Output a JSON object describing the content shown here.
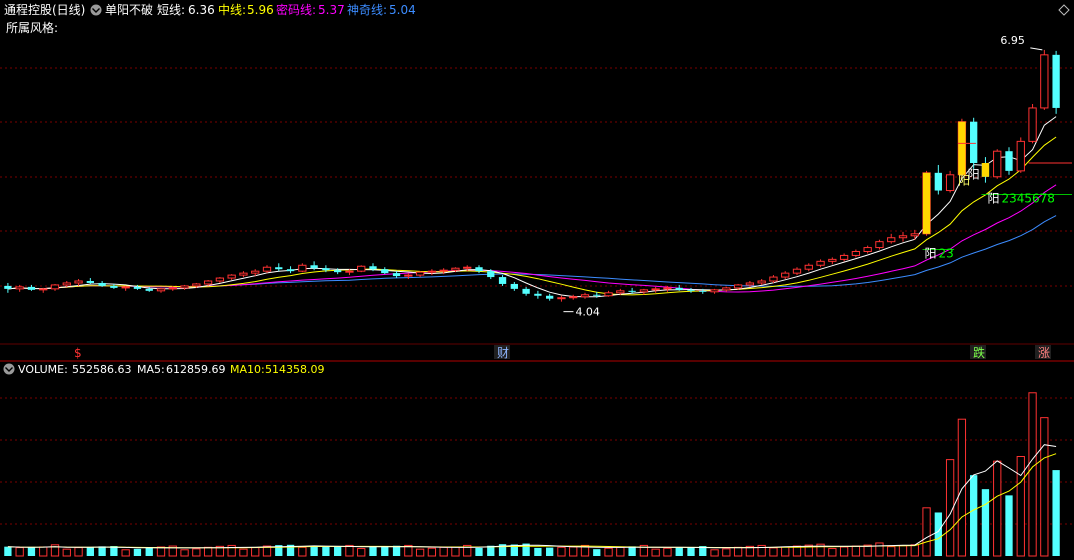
{
  "header": {
    "stock_title": "通程控股(日线)",
    "indicator_name": "单阳不破",
    "short_label": "短线:",
    "short_value": "6.36",
    "mid_label": "中线:",
    "mid_value": "5.96",
    "secret_label": "密码线:",
    "secret_value": "5.37",
    "magic_label": "神奇线:",
    "magic_value": "5.04",
    "style_label": "所属风格:"
  },
  "volume_header": {
    "volume_label": "VOLUME:",
    "volume_value": "552586.63",
    "ma5_label": "MA5:",
    "ma5_value": "612859.69",
    "ma10_label": "MA10:",
    "ma10_value": "514358.09"
  },
  "annotations": {
    "high": "6.95",
    "low": "4.04",
    "yang_marks": [
      "阳",
      "阳",
      "阳",
      "阳"
    ],
    "yang_count_a": "23",
    "yang_count_b": "2345678",
    "event_markers": [
      "$",
      "财",
      "跌",
      "涨"
    ]
  },
  "colors": {
    "up": "#ff3232",
    "down": "#54ffff",
    "short_line": "#ffffff",
    "mid_line": "#ffff00",
    "secret_line": "#ff00ff",
    "magic_line": "#3c8cff",
    "grid": "#7a0000",
    "highlight": "#ffd700"
  },
  "chart_data": [
    {
      "type": "candlestick",
      "title": "通程控股(日线)",
      "ylim": [
        4.0,
        7.0
      ],
      "series": [
        {
          "name": "短线",
          "last": 6.36
        },
        {
          "name": "中线",
          "last": 5.96
        },
        {
          "name": "密码线",
          "last": 5.37
        },
        {
          "name": "神奇线",
          "last": 5.04
        }
      ],
      "candles": [
        [
          4.55,
          4.58,
          4.48,
          4.52
        ],
        [
          4.52,
          4.56,
          4.49,
          4.54
        ],
        [
          4.54,
          4.56,
          4.5,
          4.51
        ],
        [
          4.51,
          4.53,
          4.48,
          4.52
        ],
        [
          4.52,
          4.57,
          4.5,
          4.56
        ],
        [
          4.56,
          4.6,
          4.54,
          4.58
        ],
        [
          4.58,
          4.62,
          4.55,
          4.6
        ],
        [
          4.6,
          4.63,
          4.57,
          4.58
        ],
        [
          4.58,
          4.6,
          4.54,
          4.55
        ],
        [
          4.55,
          4.57,
          4.52,
          4.53
        ],
        [
          4.53,
          4.55,
          4.5,
          4.54
        ],
        [
          4.54,
          4.56,
          4.51,
          4.52
        ],
        [
          4.52,
          4.54,
          4.49,
          4.5
        ],
        [
          4.5,
          4.53,
          4.48,
          4.52
        ],
        [
          4.52,
          4.55,
          4.5,
          4.53
        ],
        [
          4.53,
          4.56,
          4.51,
          4.55
        ],
        [
          4.55,
          4.58,
          4.53,
          4.57
        ],
        [
          4.57,
          4.61,
          4.55,
          4.6
        ],
        [
          4.6,
          4.64,
          4.58,
          4.63
        ],
        [
          4.63,
          4.67,
          4.61,
          4.66
        ],
        [
          4.66,
          4.7,
          4.64,
          4.68
        ],
        [
          4.68,
          4.72,
          4.65,
          4.7
        ],
        [
          4.7,
          4.76,
          4.68,
          4.74
        ],
        [
          4.74,
          4.78,
          4.7,
          4.72
        ],
        [
          4.72,
          4.75,
          4.68,
          4.7
        ],
        [
          4.7,
          4.78,
          4.69,
          4.76
        ],
        [
          4.76,
          4.8,
          4.71,
          4.73
        ],
        [
          4.73,
          4.76,
          4.69,
          4.71
        ],
        [
          4.71,
          4.73,
          4.67,
          4.69
        ],
        [
          4.69,
          4.72,
          4.66,
          4.7
        ],
        [
          4.7,
          4.76,
          4.69,
          4.75
        ],
        [
          4.75,
          4.78,
          4.7,
          4.72
        ],
        [
          4.72,
          4.74,
          4.67,
          4.68
        ],
        [
          4.68,
          4.7,
          4.63,
          4.65
        ],
        [
          4.65,
          4.68,
          4.62,
          4.66
        ],
        [
          4.66,
          4.7,
          4.64,
          4.69
        ],
        [
          4.69,
          4.72,
          4.66,
          4.7
        ],
        [
          4.7,
          4.73,
          4.67,
          4.71
        ],
        [
          4.71,
          4.74,
          4.69,
          4.73
        ],
        [
          4.73,
          4.76,
          4.7,
          4.74
        ],
        [
          4.74,
          4.76,
          4.68,
          4.7
        ],
        [
          4.7,
          4.72,
          4.62,
          4.64
        ],
        [
          4.64,
          4.66,
          4.55,
          4.57
        ],
        [
          4.57,
          4.59,
          4.5,
          4.52
        ],
        [
          4.52,
          4.54,
          4.45,
          4.47
        ],
        [
          4.47,
          4.5,
          4.42,
          4.45
        ],
        [
          4.45,
          4.47,
          4.4,
          4.42
        ],
        [
          4.42,
          4.45,
          4.39,
          4.43
        ],
        [
          4.43,
          4.46,
          4.41,
          4.44
        ],
        [
          4.44,
          4.48,
          4.42,
          4.46
        ],
        [
          4.46,
          4.49,
          4.43,
          4.45
        ],
        [
          4.45,
          4.5,
          4.44,
          4.48
        ],
        [
          4.48,
          4.52,
          4.46,
          4.5
        ],
        [
          4.5,
          4.53,
          4.47,
          4.49
        ],
        [
          4.49,
          4.52,
          4.46,
          4.51
        ],
        [
          4.51,
          4.54,
          4.48,
          4.52
        ],
        [
          4.52,
          4.55,
          4.49,
          4.53
        ],
        [
          4.53,
          4.56,
          4.5,
          4.51
        ],
        [
          4.51,
          4.53,
          4.48,
          4.5
        ],
        [
          4.5,
          4.52,
          4.47,
          4.49
        ],
        [
          4.49,
          4.52,
          4.47,
          4.51
        ],
        [
          4.51,
          4.54,
          4.49,
          4.53
        ],
        [
          4.53,
          4.57,
          4.51,
          4.56
        ],
        [
          4.56,
          4.6,
          4.54,
          4.58
        ],
        [
          4.58,
          4.62,
          4.56,
          4.6
        ],
        [
          4.6,
          4.66,
          4.58,
          4.64
        ],
        [
          4.64,
          4.7,
          4.62,
          4.68
        ],
        [
          4.68,
          4.74,
          4.66,
          4.72
        ],
        [
          4.72,
          4.78,
          4.7,
          4.76
        ],
        [
          4.76,
          4.82,
          4.74,
          4.8
        ],
        [
          4.8,
          4.84,
          4.77,
          4.82
        ],
        [
          4.82,
          4.88,
          4.8,
          4.86
        ],
        [
          4.86,
          4.92,
          4.84,
          4.9
        ],
        [
          4.9,
          4.96,
          4.88,
          4.94
        ],
        [
          4.94,
          5.02,
          4.92,
          5.0
        ],
        [
          5.0,
          5.08,
          4.98,
          5.04
        ],
        [
          5.04,
          5.1,
          5.0,
          5.06
        ],
        [
          5.06,
          5.12,
          5.02,
          5.08
        ],
        [
          5.08,
          5.72,
          5.06,
          5.7
        ],
        [
          5.7,
          5.78,
          5.48,
          5.52
        ],
        [
          5.52,
          5.72,
          5.5,
          5.68
        ],
        [
          5.68,
          6.25,
          5.66,
          6.22
        ],
        [
          6.22,
          6.26,
          5.74,
          5.8
        ],
        [
          5.8,
          5.86,
          5.6,
          5.66
        ],
        [
          5.66,
          5.94,
          5.64,
          5.92
        ],
        [
          5.92,
          5.96,
          5.68,
          5.72
        ],
        [
          5.72,
          6.06,
          5.7,
          6.02
        ],
        [
          6.02,
          6.4,
          6.0,
          6.36
        ],
        [
          6.36,
          6.95,
          6.34,
          6.9
        ],
        [
          6.9,
          6.94,
          6.3,
          6.36
        ]
      ]
    },
    {
      "type": "bar",
      "title": "VOLUME",
      "series": [
        {
          "name": "VOLUME",
          "last": 552586.63
        },
        {
          "name": "MA5",
          "last": 612859.69
        },
        {
          "name": "MA10",
          "last": 514358.09
        }
      ]
    }
  ]
}
